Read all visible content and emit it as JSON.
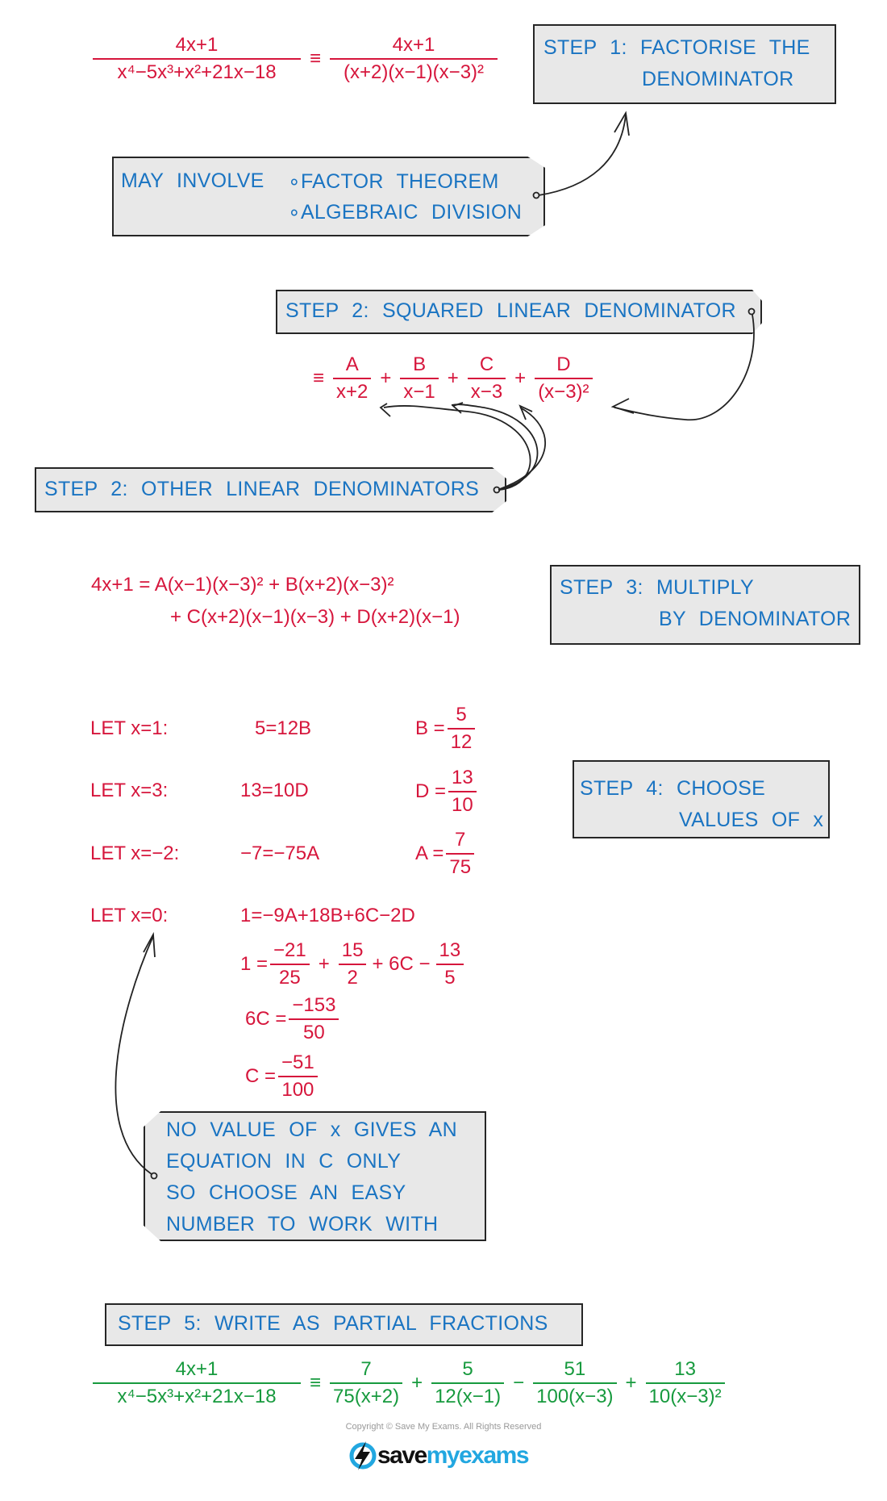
{
  "colors": {
    "work": "#d6163c",
    "annotation": "#1a74c2",
    "answer": "#179a3e",
    "box_fill": "#e8e8e8"
  },
  "eq1": {
    "lhs_num": "4x+1",
    "lhs_den": "x⁴−5x³+x²+21x−18",
    "equiv": "≡",
    "rhs_num": "4x+1",
    "rhs_den": "(x+2)(x−1)(x−3)²"
  },
  "step1": {
    "line1": "STEP 1:  FACTORISE  THE",
    "line2": "DENOMINATOR"
  },
  "involve": {
    "label": "MAY  INVOLVE",
    "item1": "∘FACTOR  THEOREM",
    "item2": "∘ALGEBRAIC  DIVISION"
  },
  "step2a": {
    "text": "STEP 2:  SQUARED  LINEAR  DENOMINATOR"
  },
  "pf": {
    "equiv": "≡",
    "terms": [
      {
        "num": "A",
        "den": "x+2"
      },
      {
        "op": "+"
      },
      {
        "num": "B",
        "den": "x−1"
      },
      {
        "op": "+"
      },
      {
        "num": "C",
        "den": "x−3"
      },
      {
        "op": "+"
      },
      {
        "num": "D",
        "den": "(x−3)²"
      }
    ]
  },
  "step2b": {
    "text": "STEP 2:  OTHER  LINEAR  DENOMINATORS"
  },
  "step3_eq": {
    "line1": "4x+1 = A(x−1)(x−3)² + B(x+2)(x−3)²",
    "line2": "+ C(x+2)(x−1)(x−3) + D(x+2)(x−1)"
  },
  "step3": {
    "line1": "STEP  3:  MULTIPLY",
    "line2": "BY  DENOMINATOR"
  },
  "lets": [
    {
      "label": "LET  x=1:",
      "eq": "5=12B",
      "res_var": "B =",
      "res_num": "5",
      "res_den": "12"
    },
    {
      "label": "LET  x=3:",
      "eq": "13=10D",
      "res_var": "D =",
      "res_num": "13",
      "res_den": "10"
    },
    {
      "label": "LET  x=−2:",
      "eq": "−7=−75A",
      "res_var": "A =",
      "res_num": "7",
      "res_den": "75"
    },
    {
      "label": "LET  x=0:",
      "eq": "1=−9A+18B+6C−2D"
    }
  ],
  "step4": {
    "line1": "STEP  4:  CHOOSE",
    "line2": "VALUES  OF  x"
  },
  "solve": {
    "l1": {
      "lhs": "1 =",
      "f1n": "−21",
      "f1d": "25",
      "op1": "+",
      "f2n": "15",
      "f2d": "2",
      "mid": "+ 6C −",
      "f3n": "13",
      "f3d": "5"
    },
    "l2": {
      "lhs": "6C =",
      "n": "−153",
      "d": "50"
    },
    "l3": {
      "lhs": "C =",
      "n": "−51",
      "d": "100"
    }
  },
  "novalue": {
    "lines": [
      "NO  VALUE  OF  x  GIVES  AN",
      "EQUATION  IN  C  ONLY",
      "SO  CHOOSE  AN  EASY",
      "NUMBER  TO  WORK  WITH"
    ]
  },
  "step5": {
    "text": "STEP  5:  WRITE  AS  PARTIAL  FRACTIONS"
  },
  "final": {
    "lhs_num": "4x+1",
    "lhs_den": "x⁴−5x³+x²+21x−18",
    "equiv": "≡",
    "terms": [
      {
        "num": "7",
        "den": "75(x+2)"
      },
      {
        "op": "+"
      },
      {
        "num": "5",
        "den": "12(x−1)"
      },
      {
        "op": "−"
      },
      {
        "num": "51",
        "den": "100(x−3)"
      },
      {
        "op": "+"
      },
      {
        "num": "13",
        "den": "10(x−3)²"
      }
    ]
  },
  "footer": {
    "copyright": "Copyright © Save My Exams. All Rights Reserved",
    "logo_a": "save",
    "logo_b": "myexams",
    "logo_icon": "lightning-bolt-icon"
  }
}
